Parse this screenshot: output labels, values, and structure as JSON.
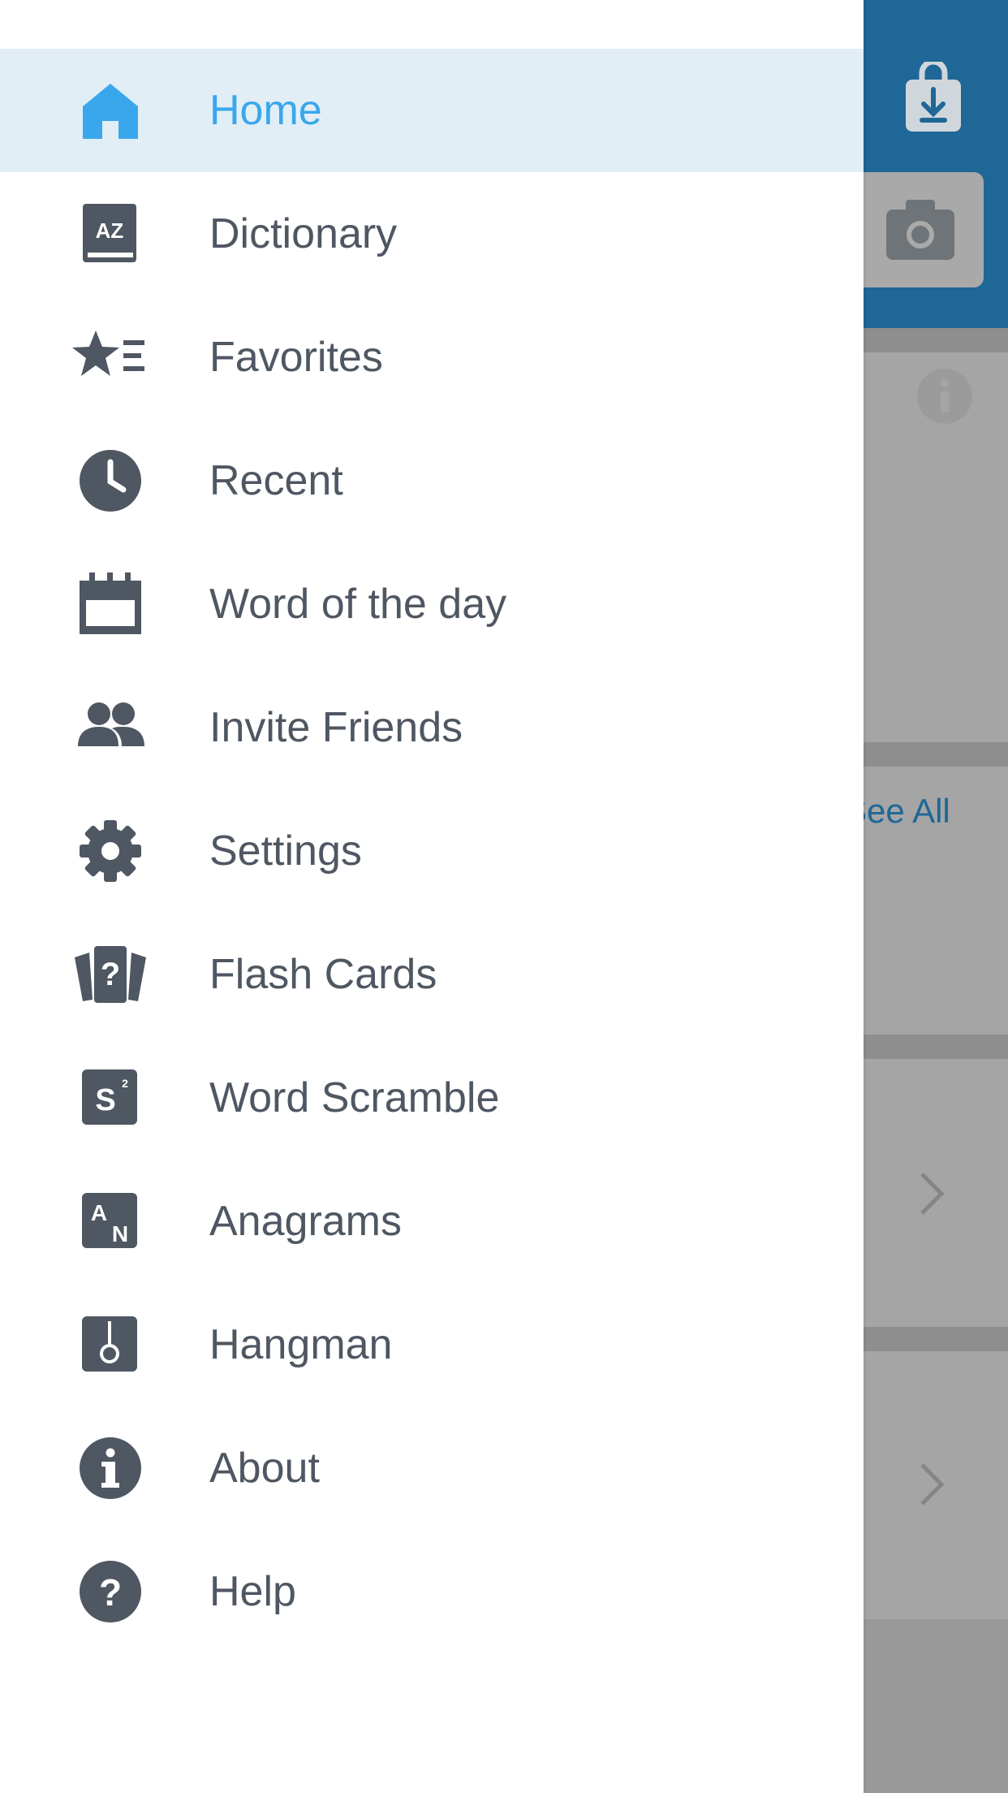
{
  "drawer": {
    "items": [
      {
        "label": "Home",
        "icon": "home-icon",
        "active": true
      },
      {
        "label": "Dictionary",
        "icon": "dictionary-icon"
      },
      {
        "label": "Favorites",
        "icon": "favorites-icon"
      },
      {
        "label": "Recent",
        "icon": "clock-icon"
      },
      {
        "label": "Word of the day",
        "icon": "calendar-icon"
      },
      {
        "label": "Invite Friends",
        "icon": "people-icon"
      },
      {
        "label": "Settings",
        "icon": "gear-icon"
      },
      {
        "label": "Flash Cards",
        "icon": "flash-cards-icon"
      },
      {
        "label": "Word Scramble",
        "icon": "word-scramble-icon"
      },
      {
        "label": "Anagrams",
        "icon": "anagrams-icon"
      },
      {
        "label": "Hangman",
        "icon": "hangman-icon"
      },
      {
        "label": "About",
        "icon": "info-icon"
      },
      {
        "label": "Help",
        "icon": "help-icon"
      }
    ]
  },
  "background": {
    "see_all_label": "See All"
  },
  "colors": {
    "accent": "#3aa7ec",
    "active_row": "#e1eef6",
    "text": "#4e5762",
    "header": "#1f6796"
  }
}
